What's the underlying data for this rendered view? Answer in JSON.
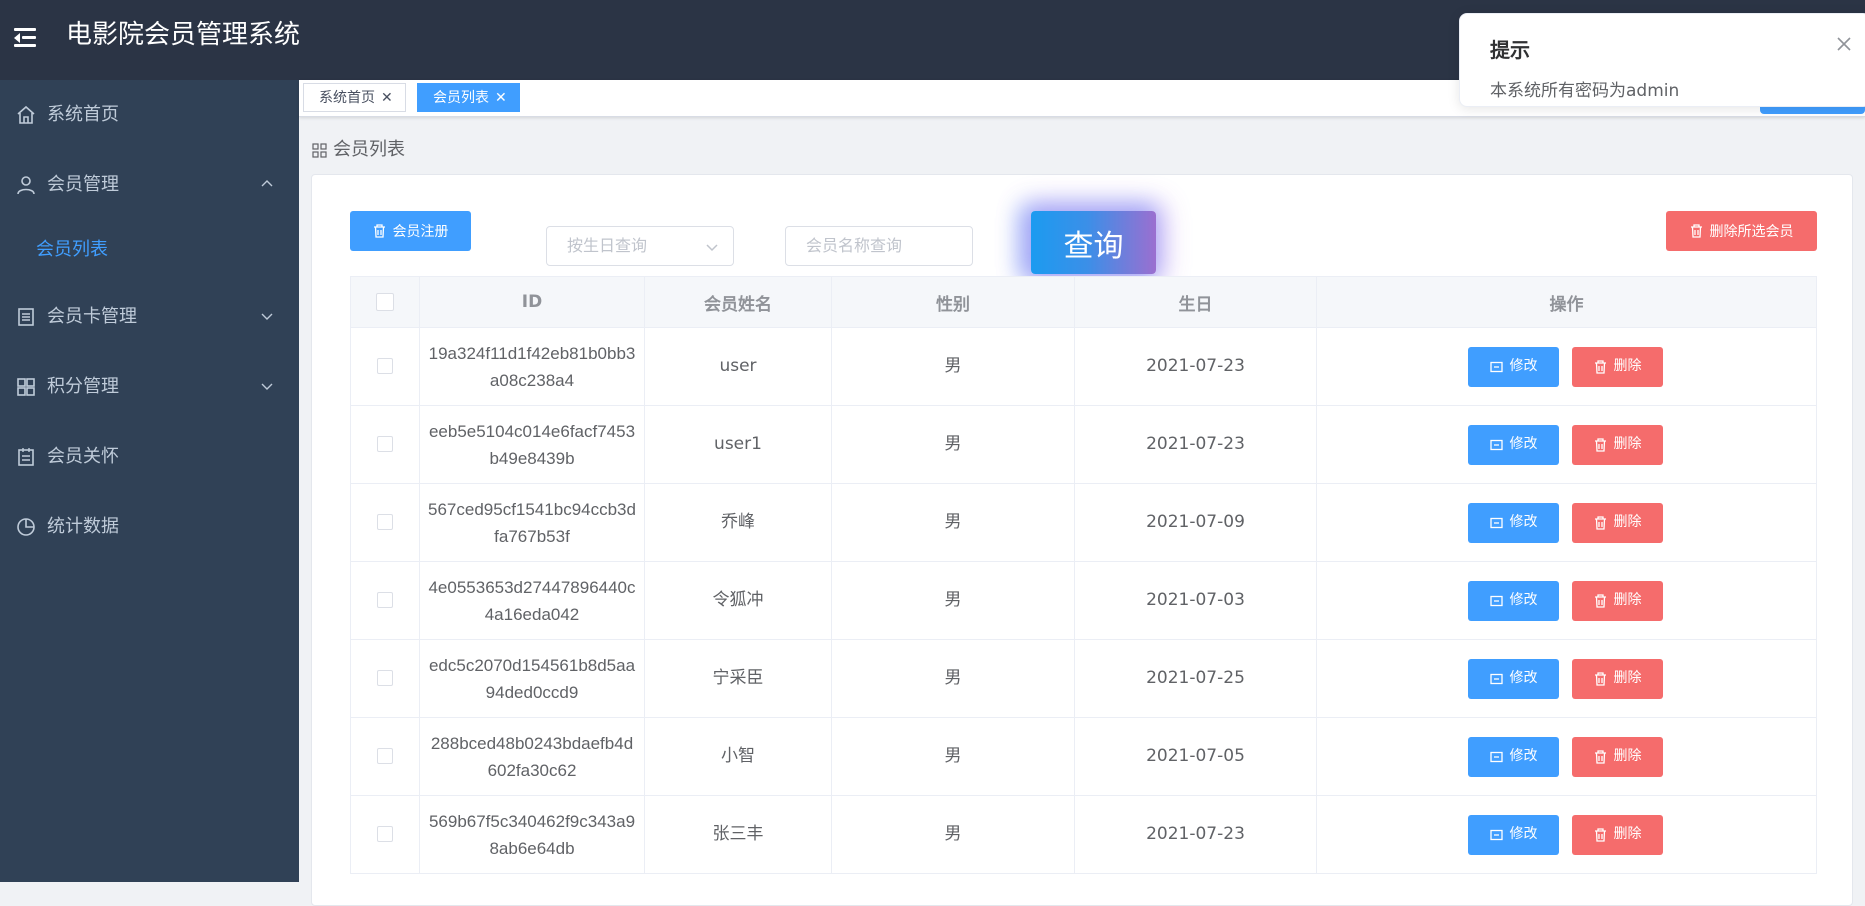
{
  "app": {
    "title": "电影院会员管理系统"
  },
  "sidebar": {
    "items": [
      {
        "label": "系统首页",
        "icon": "home-icon"
      },
      {
        "label": "会员管理",
        "icon": "user-icon",
        "expanded": true
      },
      {
        "label": "会员列表",
        "sub": true,
        "active": true
      },
      {
        "label": "会员卡管理",
        "icon": "card-icon",
        "expanded": false
      },
      {
        "label": "积分管理",
        "icon": "grid-icon",
        "expanded": false
      },
      {
        "label": "会员关怀",
        "icon": "notebook-icon"
      },
      {
        "label": "统计数据",
        "icon": "pie-chart-icon"
      }
    ]
  },
  "tags": [
    {
      "label": "系统首页",
      "active": false
    },
    {
      "label": "会员列表",
      "active": true
    }
  ],
  "breadcrumb": {
    "label": "会员列表"
  },
  "toolbar": {
    "register_label": "会员注册",
    "birthday_placeholder": "按生日查询",
    "name_placeholder": "会员名称查询",
    "query_label": "查询",
    "delete_selected_label": "删除所选会员"
  },
  "table": {
    "headers": [
      "ID",
      "会员姓名",
      "性别",
      "生日",
      "操作"
    ],
    "rows": [
      {
        "id": "19a324f11d1f42eb81b0bb3a08c238a4",
        "name": "user",
        "gender": "男",
        "birthday": "2021-07-23"
      },
      {
        "id": "eeb5e5104c014e6facf7453b49e8439b",
        "name": "user1",
        "gender": "男",
        "birthday": "2021-07-23"
      },
      {
        "id": "567ced95cf1541bc94ccb3dfa767b53f",
        "name": "乔峰",
        "gender": "男",
        "birthday": "2021-07-09"
      },
      {
        "id": "4e0553653d27447896440c4a16eda042",
        "name": "令狐冲",
        "gender": "男",
        "birthday": "2021-07-03"
      },
      {
        "id": "edc5c2070d154561b8d5aa94ded0ccd9",
        "name": "宁采臣",
        "gender": "男",
        "birthday": "2021-07-25"
      },
      {
        "id": "288bced48b0243bdaefb4d602fa30c62",
        "name": "小智",
        "gender": "男",
        "birthday": "2021-07-05"
      },
      {
        "id": "569b67f5c340462f9c343a98ab6e64db",
        "name": "张三丰",
        "gender": "男",
        "birthday": "2021-07-23"
      }
    ],
    "edit_label": "修改",
    "delete_label": "删除"
  },
  "toast": {
    "title": "提示",
    "message": "本系统所有密码为admin"
  },
  "colors": {
    "primary": "#409eff",
    "danger": "#f56c6c",
    "sidebar": "#304156",
    "header": "#2b3445"
  }
}
